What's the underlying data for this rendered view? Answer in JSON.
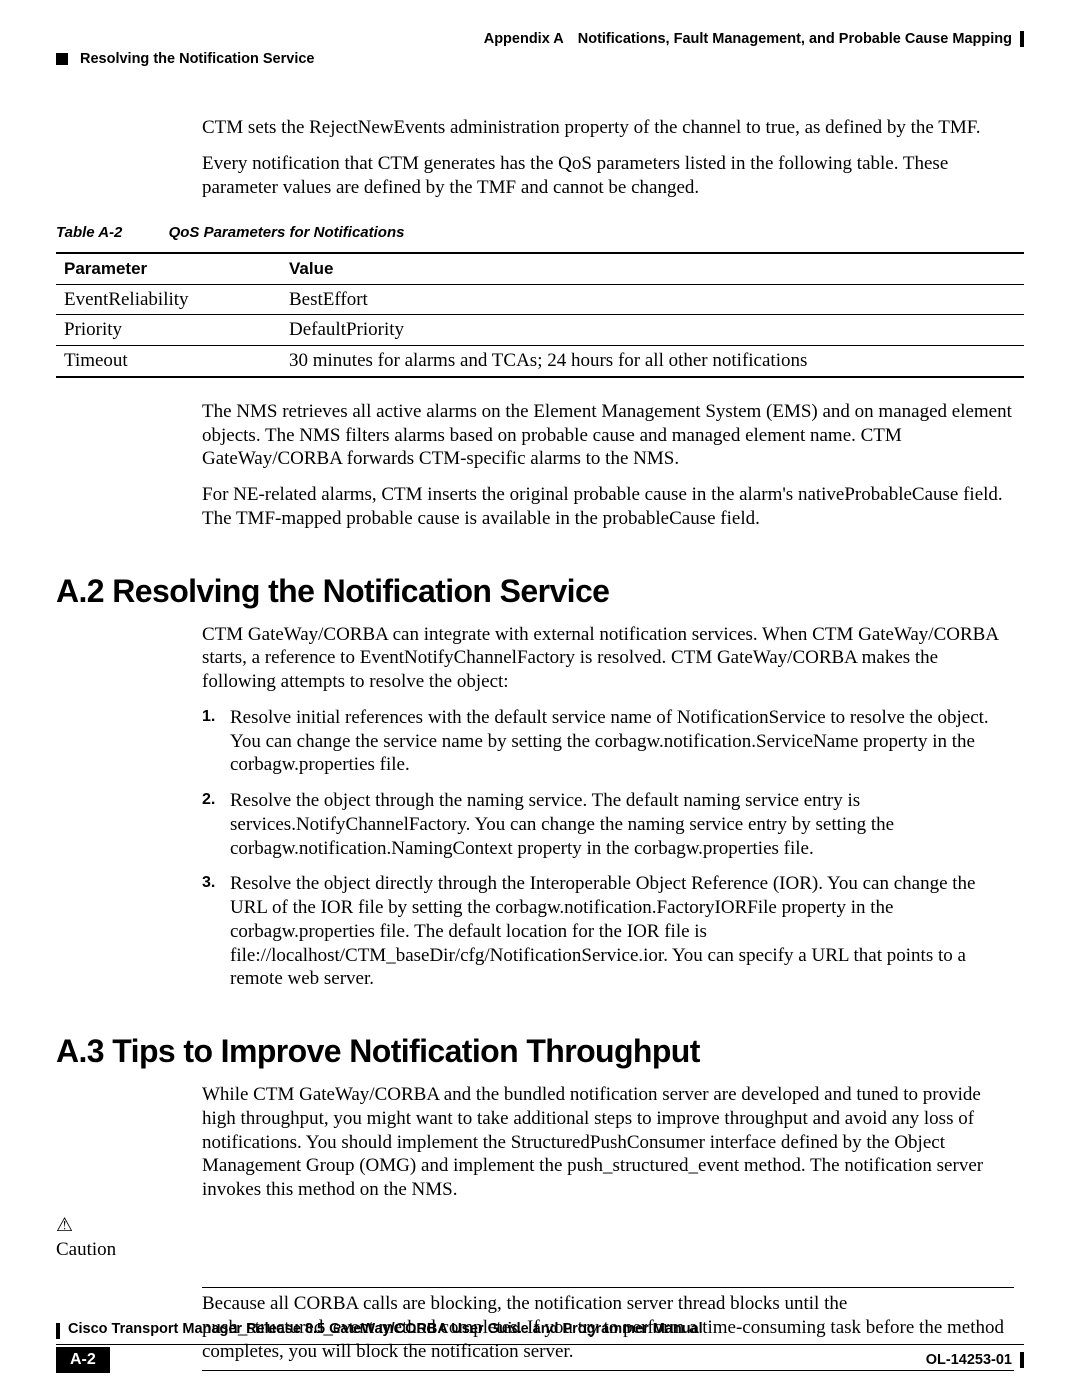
{
  "header": {
    "appendix": "Appendix A",
    "title": "Notifications, Fault Management, and Probable Cause Mapping",
    "section": "Resolving the Notification Service"
  },
  "intro": {
    "p1": "CTM sets the RejectNewEvents administration property of the channel to true, as defined by the TMF.",
    "p2": "Every notification that CTM generates has the QoS parameters listed in the following table. These parameter values are defined by the TMF and cannot be changed."
  },
  "table": {
    "caption_no": "Table A-2",
    "caption_title": "QoS Parameters for Notifications",
    "head": {
      "c1": "Parameter",
      "c2": "Value"
    },
    "rows": [
      {
        "c1": "EventReliability",
        "c2": "BestEffort"
      },
      {
        "c1": "Priority",
        "c2": "DefaultPriority"
      },
      {
        "c1": "Timeout",
        "c2": "30 minutes for alarms and TCAs; 24 hours for all other notifications"
      }
    ]
  },
  "after_table": {
    "p1": "The NMS retrieves all active alarms on the Element Management System (EMS) and on managed element objects. The NMS filters alarms based on probable cause and managed element name. CTM GateWay/CORBA forwards CTM-specific alarms to the NMS.",
    "p2": "For NE-related alarms, CTM inserts the original probable cause in the alarm's nativeProbableCause field. The TMF-mapped probable cause is available in the probableCause field."
  },
  "sectionA2": {
    "heading": "A.2  Resolving the Notification Service",
    "p1": "CTM GateWay/CORBA can integrate with external notification services. When CTM GateWay/CORBA starts, a reference to EventNotifyChannelFactory is resolved. CTM GateWay/CORBA makes the following attempts to resolve the object:",
    "steps": [
      "Resolve initial references with the default service name of NotificationService to resolve the object. You can change the service name by setting the corbagw.notification.ServiceName property in the corbagw.properties file.",
      "Resolve the object through the naming service. The default naming service entry is services.NotifyChannelFactory. You can change the naming service entry by setting the corbagw.notification.NamingContext property in the corbagw.properties file.",
      "Resolve the object directly through the Interoperable Object Reference (IOR). You can change the URL of the IOR file by setting the corbagw.notification.FactoryIORFile property in the corbagw.properties file. The default location for the IOR file is file://localhost/CTM_baseDir/cfg/NotificationService.ior. You can specify a URL that points to a remote web server."
    ]
  },
  "sectionA3": {
    "heading": "A.3  Tips to Improve Notification Throughput",
    "p1": "While CTM GateWay/CORBA and the bundled notification server are developed and tuned to provide high throughput, you might want to take additional steps to improve throughput and avoid any loss of notifications. You should implement the StructuredPushConsumer interface defined by the Object Management Group (OMG) and implement the push_structured_event method. The notification server invokes this method on the NMS."
  },
  "caution": {
    "label": "Caution",
    "text": "Because all CORBA calls are blocking, the notification server thread blocks until the push_structured_event method completes. If you try to perform a time-consuming task before the method completes, you will block the notification server."
  },
  "footer": {
    "manual": "Cisco Transport Manager Release 8.5 GateWay/CORBA User Guide and Programmer Manual",
    "page": "A-2",
    "docno": "OL-14253-01"
  }
}
